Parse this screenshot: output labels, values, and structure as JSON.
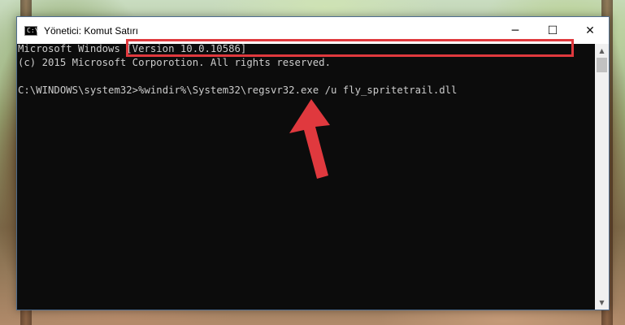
{
  "window": {
    "title": "Yönetici: Komut Satırı",
    "icon": "cmd-icon",
    "icon_text": "C:\\",
    "controls": {
      "minimize": "─",
      "maximize": "☐",
      "close": "✕"
    }
  },
  "console": {
    "line1": "Microsoft Windows [Version 10.0.10586]",
    "line2": "(c) 2015 Microsoft Corporotion. All rights reserved.",
    "prompt": "C:\\WINDOWS\\system32>",
    "command": "%windir%\\System32\\regsvr32.exe /u fly_spritetrail.dll"
  },
  "scrollbar": {
    "up": "▲",
    "down": "▼"
  },
  "annotation": {
    "highlight_color": "#e0393e",
    "arrow_color": "#e0393e"
  }
}
